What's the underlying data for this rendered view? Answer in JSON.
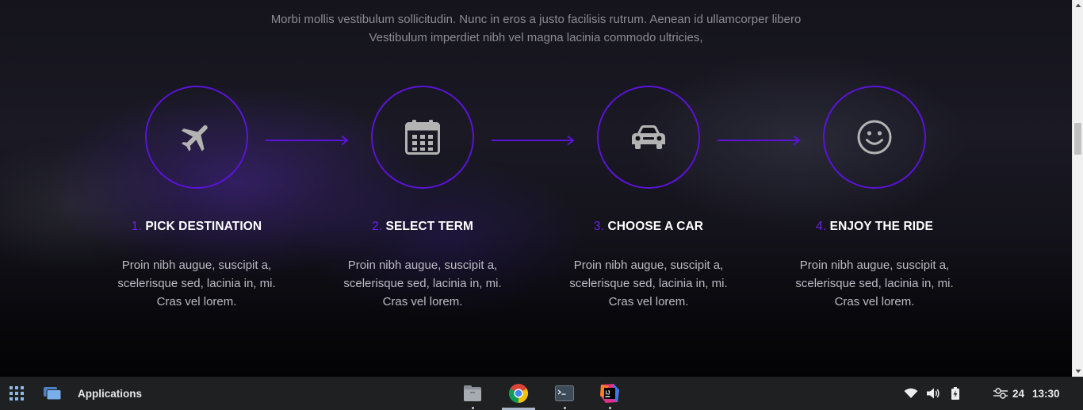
{
  "intro": {
    "line1": "Morbi mollis vestibulum sollicitudin. Nunc in eros a justo facilisis rutrum. Aenean id ullamcorper libero",
    "line2": "Vestibulum imperdiet nibh vel magna lacinia commodo ultricies,"
  },
  "steps": [
    {
      "number": "1.",
      "title": "PICK DESTINATION",
      "icon": "airplane-icon",
      "description": "Proin nibh augue, suscipit a, scelerisque sed, lacinia in, mi. Cras vel lorem."
    },
    {
      "number": "2.",
      "title": "SELECT TERM",
      "icon": "calendar-icon",
      "description": "Proin nibh augue, suscipit a, scelerisque sed, lacinia in, mi. Cras vel lorem."
    },
    {
      "number": "3.",
      "title": "CHOOSE A CAR",
      "icon": "car-icon",
      "description": "Proin nibh augue, suscipit a, scelerisque sed, lacinia in, mi. Cras vel lorem."
    },
    {
      "number": "4.",
      "title": "ENJOY THE RIDE",
      "icon": "smile-icon",
      "description": "Proin nibh augue, suscipit a, scelerisque sed, lacinia in, mi. Cras vel lorem."
    }
  ],
  "colors": {
    "accent": "#5b13d8",
    "step_number": "#6a22e6",
    "icon_gray": "#b3b3b3"
  },
  "taskbar": {
    "applications_label": "Applications",
    "pinned_apps": [
      "files-icon",
      "chrome-icon",
      "terminal-icon",
      "intellij-icon"
    ],
    "date": "24",
    "time": "13:30"
  }
}
